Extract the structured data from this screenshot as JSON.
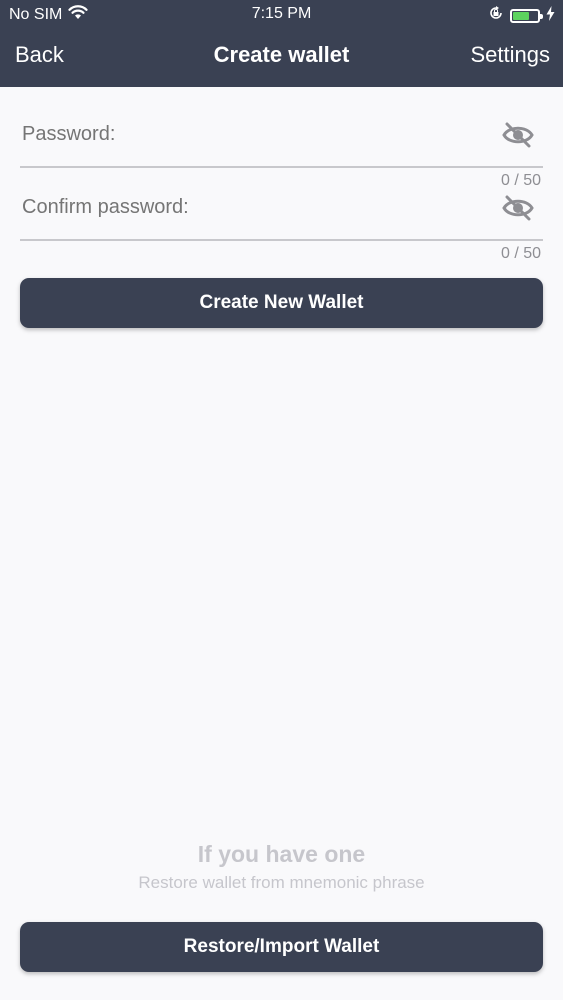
{
  "status_bar": {
    "carrier": "No SIM",
    "time": "7:15 PM",
    "battery_level": 0.6
  },
  "nav": {
    "back_label": "Back",
    "title": "Create wallet",
    "settings_label": "Settings"
  },
  "form": {
    "password": {
      "placeholder": "Password:",
      "value": "",
      "counter": "0 / 50",
      "icon": "eye-off-icon"
    },
    "confirm_password": {
      "placeholder": "Confirm password:",
      "value": "",
      "counter": "0 / 50",
      "icon": "eye-off-icon"
    },
    "create_button_label": "Create New Wallet"
  },
  "restore": {
    "hint_title": "If you have one",
    "hint_subtitle": "Restore wallet from mnemonic phrase",
    "button_label": "Restore/Import Wallet"
  },
  "colors": {
    "brand": "#3a4153",
    "background": "#f9f9fb",
    "battery": "#5dd35f"
  }
}
